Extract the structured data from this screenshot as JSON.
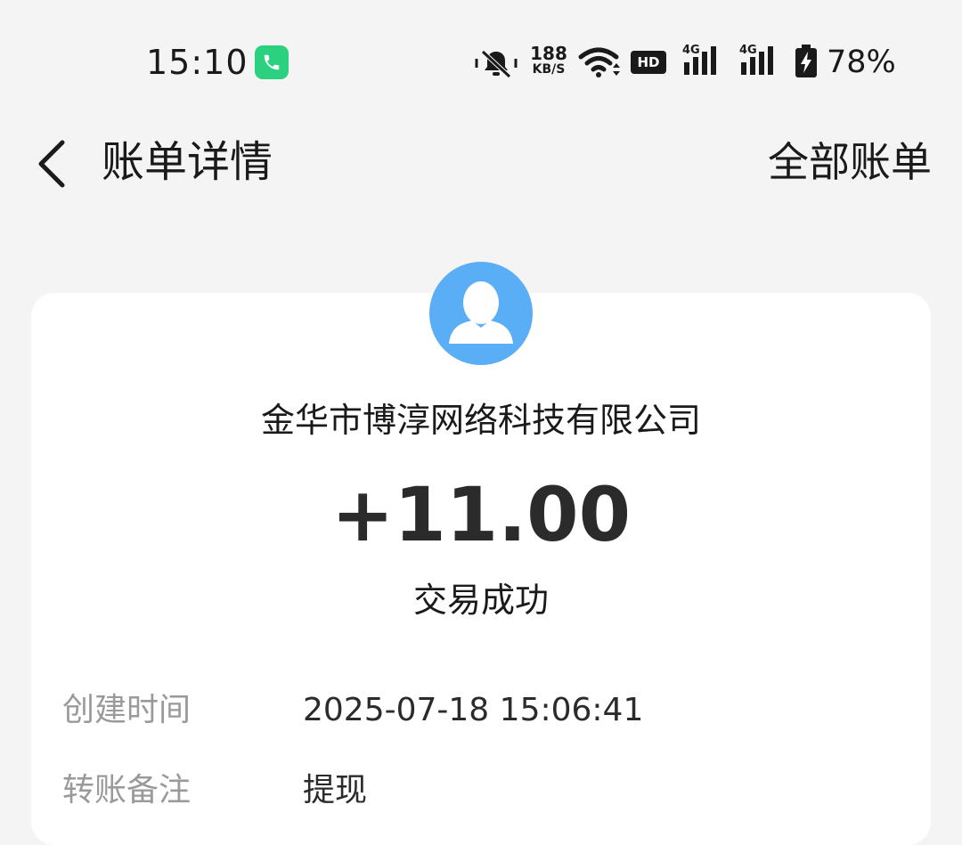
{
  "status_bar": {
    "time": "15:10",
    "net_speed_value": "188",
    "net_speed_unit": "KB/S",
    "hd_label": "HD",
    "signal_1_label": "4G",
    "signal_2_label": "4G",
    "battery": "78%",
    "icons": [
      "call-icon",
      "mute-icon",
      "wifi-icon",
      "signal-icon",
      "battery-icon"
    ]
  },
  "nav": {
    "title": "账单详情",
    "action": "全部账单"
  },
  "detail": {
    "merchant": "金华市博淳网络科技有限公司",
    "amount": "+11.00",
    "status": "交易成功",
    "rows": [
      {
        "label": "创建时间",
        "value": "2025-07-18 15:06:41"
      },
      {
        "label": "转账备注",
        "value": "提现"
      }
    ]
  },
  "colors": {
    "background": "#f4f4f4",
    "card": "#ffffff",
    "avatar": "#5aaef5",
    "call_badge": "#2bd17e",
    "label_gray": "#9a9a9a"
  }
}
